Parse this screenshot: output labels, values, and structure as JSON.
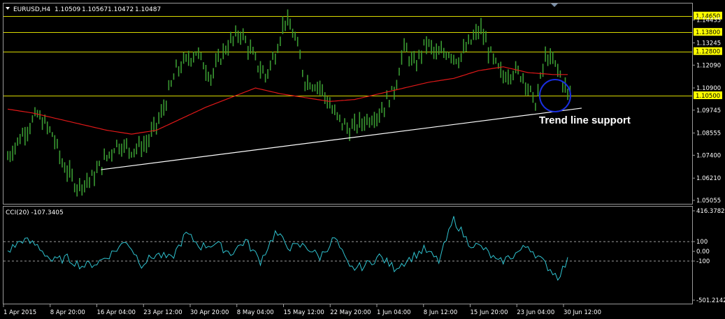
{
  "colors": {
    "background": "#000000",
    "candle": "#3a9a32",
    "ma": "#e01818",
    "horizontal_levels": "#d9d900",
    "trend_line": "#ffffff",
    "cci": "#2fc2cf",
    "circle": "#1a2fe0",
    "price_box": "#ffff00",
    "axis_text": "#ffffff",
    "border": "#9a9a9a"
  },
  "header": {
    "symbol": "EURUSD,H4",
    "open": "1.10509",
    "high": "1.10567",
    "low": "1.10472",
    "close": "1.10487"
  },
  "chart_data": [
    {
      "type": "line",
      "title": "EURUSD,H4 1.10509 1.10567 1.10472 1.10487",
      "series_style": "candlestick",
      "ylim": [
        1.05055,
        1.1475
      ],
      "y_tick_labels": [
        "1.14650",
        "1.14435",
        "1.13800",
        "1.13245",
        "1.12800",
        "1.12090",
        "1.10900",
        "1.10500",
        "1.09745",
        "1.08555",
        "1.07400",
        "1.06210",
        "1.05055"
      ],
      "x_tick_labels": [
        "1 Apr 2015",
        "8 Apr 20:00",
        "16 Apr 04:00",
        "23 Apr 12:00",
        "30 Apr 20:00",
        "8 May 04:00",
        "15 May 12:00",
        "22 May 20:00",
        "1 Jun 04:00",
        "8 Jun 12:00",
        "15 Jun 20:00",
        "23 Jun 04:00",
        "30 Jun 12:00"
      ],
      "price_path_t": [
        0,
        3,
        6,
        9,
        11,
        14,
        17,
        20,
        22,
        25,
        28,
        31,
        34,
        38,
        41,
        44,
        47,
        50,
        52,
        54,
        56,
        58,
        60,
        63,
        66,
        69,
        72,
        75,
        78
      ],
      "price_path_y": [
        1.073,
        1.085,
        1.095,
        1.085,
        1.07,
        1.058,
        1.062,
        1.073,
        1.08,
        1.077,
        1.08,
        1.095,
        1.118,
        1.128,
        1.115,
        1.13,
        1.138,
        1.123,
        1.115,
        1.127,
        1.145,
        1.135,
        1.113,
        1.11,
        1.095,
        1.087,
        1.092,
        1.096,
        1.108
      ],
      "price_path_y_tail": [
        1.13,
        1.12,
        1.133,
        1.126,
        1.128,
        1.124,
        1.132,
        1.14,
        1.125,
        1.115,
        1.118,
        1.115,
        1.1,
        1.126,
        1.12,
        1.106
      ],
      "ma_path_t": [
        0,
        5,
        10,
        15,
        20,
        25,
        30,
        35,
        40,
        45,
        50,
        55,
        60,
        65,
        70,
        75,
        80,
        85,
        90,
        95,
        100,
        105,
        110,
        113
      ],
      "ma_path_y": [
        1.098,
        1.096,
        1.093,
        1.09,
        1.087,
        1.085,
        1.087,
        1.093,
        1.099,
        1.104,
        1.109,
        1.106,
        1.104,
        1.102,
        1.103,
        1.106,
        1.109,
        1.112,
        1.114,
        1.118,
        1.12,
        1.117,
        1.116,
        1.116
      ],
      "horizontal_levels": [
        1.1465,
        1.138,
        1.128,
        1.105
      ],
      "price_box_labels": [
        "1.14650",
        "1.13800",
        "1.12800",
        "1.10500"
      ],
      "trend_line": {
        "x": [
          "16 Apr 04:00",
          "30 Jun 12:00"
        ],
        "y": [
          1.0665,
          1.0985
        ]
      },
      "annotation": "Trend line support"
    },
    {
      "type": "line",
      "title": "CCI(20) -107.3405",
      "ylim": [
        -501.2142,
        416.3782
      ],
      "y_tick_labels": [
        "416.3782",
        "100",
        "0.00",
        "-100",
        "-501.2142"
      ],
      "reference_levels": [
        100,
        -100
      ],
      "cci_t": [
        0,
        3,
        6,
        9,
        12,
        15,
        18,
        21,
        24,
        27,
        30,
        33,
        36,
        39,
        42,
        45,
        48,
        51,
        54,
        57,
        60,
        63,
        66,
        69,
        72,
        75,
        78,
        81,
        84,
        87,
        90,
        93,
        96,
        99,
        102,
        105,
        108,
        111,
        113
      ],
      "cci_y": [
        0,
        120,
        60,
        -100,
        -70,
        -150,
        -120,
        -20,
        110,
        -130,
        -30,
        -80,
        180,
        50,
        80,
        -20,
        110,
        -100,
        190,
        40,
        60,
        -60,
        140,
        -180,
        -150,
        -50,
        -170,
        -80,
        20,
        -100,
        330,
        90,
        30,
        -120,
        -40,
        60,
        -110,
        -260,
        -100
      ]
    }
  ]
}
